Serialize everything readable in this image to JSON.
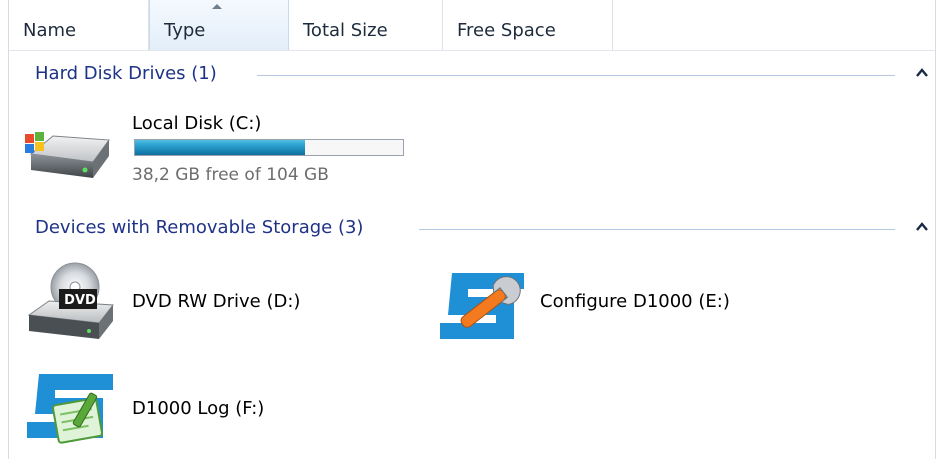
{
  "columns": [
    {
      "label": "Name"
    },
    {
      "label": "Type"
    },
    {
      "label": "Total Size"
    },
    {
      "label": "Free Space"
    }
  ],
  "groups": {
    "hard_disks": {
      "title": "Hard Disk Drives (1)",
      "items": [
        {
          "name": "Local Disk (C:)",
          "detail": "38,2 GB free of 104 GB",
          "used_fraction": 0.633,
          "icon": "hard-drive-icon"
        }
      ]
    },
    "removable": {
      "title": "Devices with Removable Storage (3)",
      "items": [
        {
          "name": "DVD RW Drive (D:)",
          "icon": "dvd-drive-icon"
        },
        {
          "name": "Configure D1000 (E:)",
          "icon": "configure-d1000-icon"
        },
        {
          "name": "D1000 Log (F:)",
          "icon": "d1000-log-icon"
        }
      ]
    }
  },
  "icon_labels": {
    "dvd_badge": "DVD"
  },
  "colors": {
    "group_title": "#1e3287",
    "bar_fill": "#1a8fc2",
    "brand_blue": "#1f8fd6",
    "wrench_orange": "#f47a1f"
  }
}
